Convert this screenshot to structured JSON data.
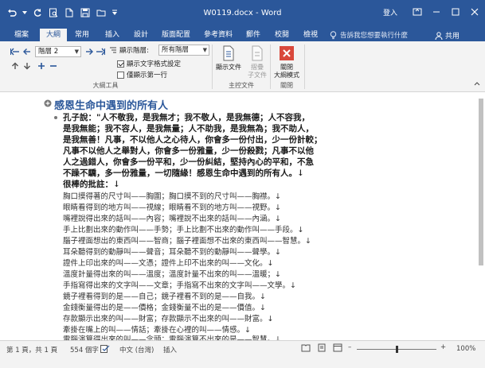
{
  "window": {
    "title": "W0119.docx - Word",
    "login_label": "登入"
  },
  "tabs": [
    {
      "label": "檔案"
    },
    {
      "label": "大綱"
    },
    {
      "label": "常用"
    },
    {
      "label": "插入"
    },
    {
      "label": "設計"
    },
    {
      "label": "版面配置"
    },
    {
      "label": "參考資料"
    },
    {
      "label": "郵件"
    },
    {
      "label": "校閱"
    },
    {
      "label": "檢視"
    }
  ],
  "tell_me": "告訴我您想要執行什麼",
  "share_label": "共用",
  "ribbon": {
    "level_select": "階層 2",
    "show_level_label": "顯示階層:",
    "show_level_value": "所有階層",
    "show_text_formatting": "顯示文字格式設定",
    "show_first_line_only": "僅顯示第一行",
    "outline_tools_label": "大綱工具",
    "show_document": "顯示文件",
    "collapse_subdocs": "摺疊\n子文件",
    "master_document_label": "主控文件",
    "close_outline": "關閉\n大綱模式",
    "close_label": "關閉"
  },
  "document": {
    "heading": "感恩生命中遇到的所有人",
    "paragraph_lines": [
      "孔子說：\"人不敬我，是我無才；我不敬人，是我無德；人不容我，",
      "是我無能；我不容人，是我無量；人不助我，是我無為；我不助人，",
      "是我無善！凡事，不以他人之心待人，你會多一份付出，少一份計較；",
      "凡事不以他人之舉對人，你會多一份雅量，少一份殺戮；凡事不以他",
      "人之過錯人，你會多一份平和，少一份糾結，堅持內心的平和，不急",
      "不躁不驕，多一份雅量，一切隨緣！感恩生命中遇到的所有人。↓",
      "很棒的批註：↓"
    ],
    "list_items": [
      "胸口摸得著的尺寸叫——胸圍；胸口摸不到的尺寸叫——胸襟。↓",
      "眼睛看得到的地方叫——視線；眼睛看不到的地方叫——視野。↓",
      "嘴裡說得出來的話叫——內容；嘴裡說不出來的話叫——內涵。↓",
      "手上比劃出來的動作叫——手勢；手上比劃不出來的動作叫——手段。↓",
      "腦子裡面想出的東西叫——智商；腦子裡面想不出來的東西叫——智慧。↓",
      "耳朵聽得到的動靜叫——聲音；耳朵聽不到的動靜叫——聲學。↓",
      "證件上印出來的叫——文憑；證件上印不出來的叫——文化。↓",
      "溫度計量得出來的叫——溫度；溫度計量不出來的叫——溫暖；↓",
      "手指寫得出來的文字叫——文章；手指寫不出來的文字叫——文學。↓",
      "鏡子裡看得到的是——自己；鏡子裡看不到的是——自我。↓",
      "金錢衡量得出的是——價格；金錢衡量不出的是——價值。↓",
      "存款顯示出來的叫——財富；存款顯示不出來的叫——財富。↓",
      "牽掛在嘴上的叫——情話；牽掛在心裡的叫——情感。↓",
      "電腦演算得出來的叫——念頭；電腦演算不出來的是——智慧。↓"
    ]
  },
  "status": {
    "page": "第 1 頁，共 1 頁",
    "words": "554 個字",
    "language": "中文 (台灣)",
    "mode": "插入",
    "zoom": "100%"
  },
  "colors": {
    "accent": "#2b579a",
    "close_red": "#d9483b"
  }
}
